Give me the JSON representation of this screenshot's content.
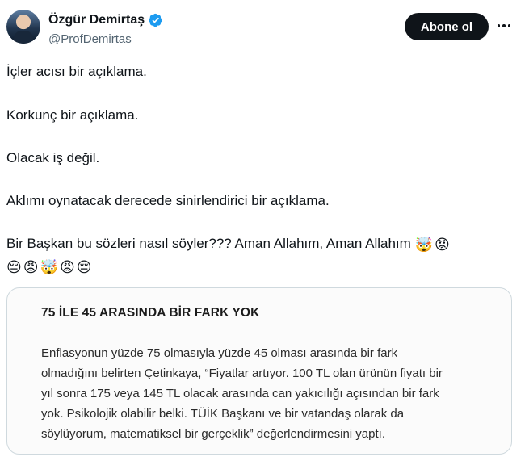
{
  "tweet": {
    "author": {
      "name": "Özgür Demirtaş",
      "handle": "@ProfDemirtas",
      "verified": true,
      "verified_color": "#1d9bf0"
    },
    "follow_label": "Abone ol",
    "more_icon": "more-horizontal-icon",
    "paragraphs": [
      "İçler acısı bir açıklama.",
      "Korkunç bir açıklama.",
      "Olacak iş değil.",
      "Aklımı oynatacak derecede sinirlendirici bir açıklama."
    ],
    "last_line_text": "Bir Başkan bu sözleri nasıl söyler??? Aman Allahım, Aman Allahım",
    "emojis_line1": [
      "🤯",
      "😡"
    ],
    "emojis_line2": [
      "😔",
      "😡",
      "🤯",
      "😡",
      "😔"
    ],
    "card": {
      "title": "75 İLE 45 ARASINDA BİR FARK YOK",
      "lines": [
        "Enflasyonun yüzde 75 olmasıyla yüzde 45 olması arasında bir fark",
        "olmadığını belirten Çetinkaya, “Fiyatlar artıyor. 100 TL olan ürünün fiyatı bir",
        "yıl sonra 175 veya 145 TL olacak arasında can yakıcılığı açısından bir fark",
        "yok. Psikolojik olabilir belki. TÜİK Başkanı ve bir vatandaş olarak da",
        "söylüyorum, matematiksel bir gerçeklik” değerlendirmesini yaptı."
      ]
    }
  }
}
